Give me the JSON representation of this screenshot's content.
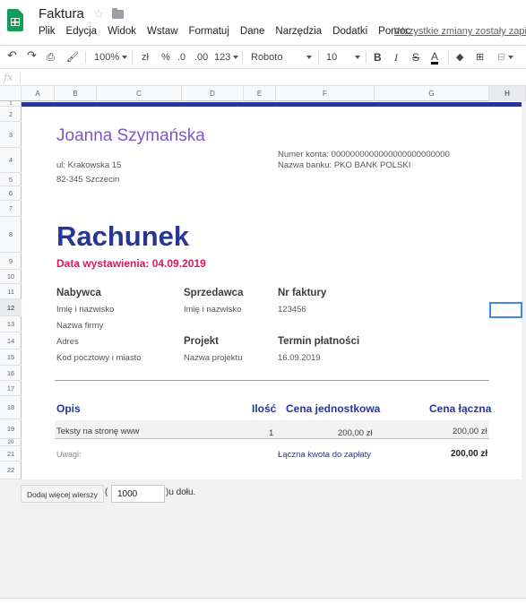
{
  "app": {
    "doc_title": "Faktura",
    "save_status": "Wszystkie zmiany zostały zapisane",
    "menu": [
      "Plik",
      "Edycja",
      "Widok",
      "Wstaw",
      "Formatuj",
      "Dane",
      "Narzędzia",
      "Dodatki",
      "Pomoc"
    ]
  },
  "toolbar": {
    "zoom": "100%",
    "currency": "zł",
    "percent": "%",
    "dec_less": ".0",
    "dec_more": ".00",
    "more_formats": "123",
    "font": "Roboto",
    "font_size": "10",
    "bold": "B",
    "italic": "I",
    "strike": "S",
    "text_color": "A"
  },
  "formula_bar": {
    "fx": "fx"
  },
  "columns": [
    "A",
    "B",
    "C",
    "D",
    "E",
    "F",
    "G",
    "H"
  ],
  "rows": [
    "1",
    "2",
    "3",
    "4",
    "5",
    "6",
    "7",
    "8",
    "9",
    "10",
    "11",
    "12",
    "13",
    "14",
    "15",
    "16",
    "17",
    "18",
    "19",
    "20",
    "21",
    "22"
  ],
  "invoice": {
    "name": "Joanna Szymańska",
    "street": "ul: Krakowska 15",
    "city": "82-345  Szczecin",
    "account": "Numer konta: 0000000000000000000000000",
    "bank": "Nazwa banku: PKO BANK POLSKI",
    "heading": "Rachunek",
    "issue_date": "Data wystawienia: 04.09.2019",
    "buyer_label": "Nabywca",
    "buyer_name": "Imię i nazwisko",
    "buyer_company": "Nazwa firmy",
    "buyer_address": "Adres",
    "buyer_postal": "Kod pocztowy i miasto",
    "seller_label": "Sprzedawca",
    "seller_name": "Imię i nazwisko",
    "project_label": "Projekt",
    "project_name": "Nazwa projektu",
    "invoice_no_label": "Nr faktury",
    "invoice_no": "123456",
    "due_label": "Termin płatności",
    "due_date": "16.09.2019",
    "table": {
      "headers": [
        "Opis",
        "Ilość",
        "Cena jednostkowa",
        "Cena łączna"
      ],
      "rows": [
        {
          "desc": "Teksty na stronę www",
          "qty": "1",
          "unit": "200,00 zł",
          "total": "200,00 zł"
        }
      ]
    },
    "notes_label": "Uwagi:",
    "total_label": "Łączna kwota do zapłaty",
    "total_value": "200,00 zł"
  },
  "footer": {
    "add_rows_label": "Dodaj więcej wierszy",
    "rows_value": "1000",
    "open_paren": "(",
    "suffix": ")u dołu."
  }
}
